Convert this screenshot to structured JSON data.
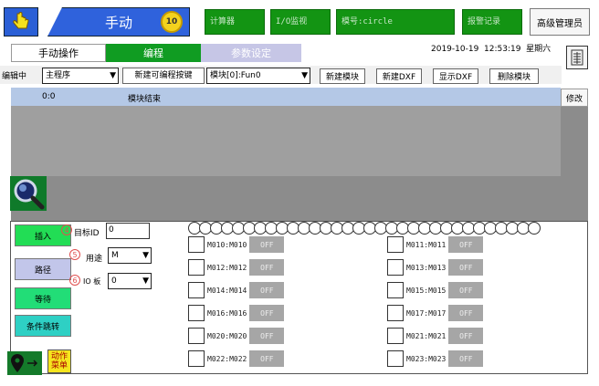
{
  "header": {
    "mode_title": "手动",
    "badge": "10",
    "boxes": [
      "计算器",
      "I/O监视",
      "模号:circle",
      "报警记录"
    ],
    "admin_label": "高级管理员"
  },
  "tabs": [
    {
      "label": "手动操作"
    },
    {
      "label": "编程"
    },
    {
      "label": "参数设定"
    }
  ],
  "datetime": "2019-10-19  12:53:19  星期六",
  "toolbar": {
    "edit_label": "编辑中",
    "program_select": "主程序",
    "new_button_select": "新建可编程按键",
    "module_select": "模块[0]:Fun0",
    "buttons": [
      "新建模块",
      "新建DXF",
      "显示DXF",
      "删除模块"
    ]
  },
  "grid": {
    "row_id": "0:0",
    "row_text": "模块结束",
    "edit_button": "修改"
  },
  "left_buttons": [
    "插入",
    "路径",
    "等待",
    "条件跳转"
  ],
  "action_menu": "动作\n菜单",
  "form": {
    "target_label": "目标ID",
    "target_value": "0",
    "use_label": "用途",
    "use_value": "M",
    "io_label": "IO 板",
    "io_value": "0",
    "markers": [
      "4",
      "5",
      "6"
    ]
  },
  "io_rows": [
    {
      "left": "M010:M010",
      "right": "M011:M011"
    },
    {
      "left": "M012:M012",
      "right": "M013:M013"
    },
    {
      "left": "M014:M014",
      "right": "M015:M015"
    },
    {
      "left": "M016:M016",
      "right": "M017:M017"
    },
    {
      "left": "M020:M020",
      "right": "M021:M021"
    },
    {
      "left": "M022:M022",
      "right": "M023:M023"
    }
  ],
  "off_label": "OFF",
  "colors": {
    "blue": "#2f62dc",
    "green": "#139413",
    "bright_green": "#22dd55",
    "header_row": "#b4c8e6"
  }
}
